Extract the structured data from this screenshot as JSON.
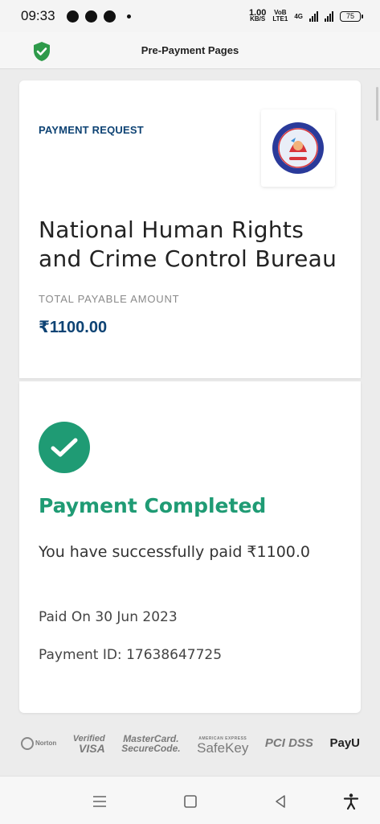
{
  "status_bar": {
    "time": "09:33",
    "net_speed_value": "1.00",
    "net_speed_unit": "KB/S",
    "volte_top": "VoB",
    "volte_bottom": "LTE1",
    "network": "4G",
    "battery": "75"
  },
  "header": {
    "title": "Pre-Payment Pages",
    "shield_color": "#2e9a4a"
  },
  "request": {
    "label": "PAYMENT REQUEST",
    "org_name_line1": "National Human Rights",
    "org_name_line2": "and Crime Control Bureau",
    "amount_label": "TOTAL PAYABLE AMOUNT",
    "amount": "₹1100.00"
  },
  "result": {
    "title": "Payment Completed",
    "message": "You have successfully paid ₹1100.0",
    "paid_on": "Paid On 30 Jun 2023",
    "payment_id": "Payment ID: 17638647725",
    "accent": "#1f9b74"
  },
  "badges": {
    "norton": "Norton",
    "visa_top": "Verified",
    "visa_bottom": "VISA",
    "mc_top": "MasterCard.",
    "mc_bottom": "SecureCode.",
    "amex_small": "AMERICAN EXPRESS",
    "safekey": "SafeKey",
    "pci": "PCI DSS",
    "payu": "PayU"
  },
  "colors": {
    "brand_blue": "#0e4374",
    "success_green": "#1f9b74"
  }
}
